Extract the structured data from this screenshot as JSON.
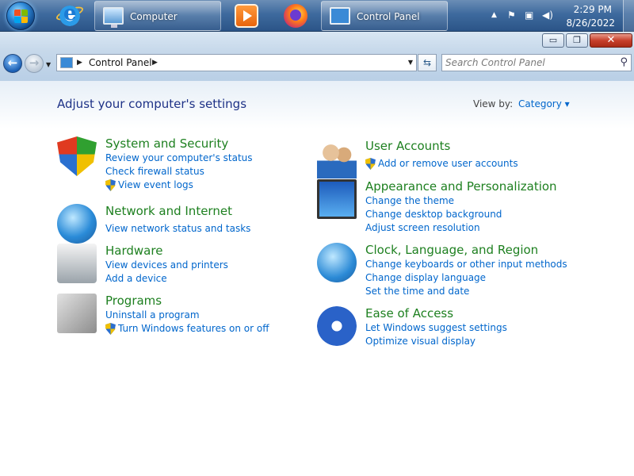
{
  "taskbar": {
    "buttons": [
      {
        "label": "Computer"
      },
      {
        "label": "Control Panel"
      }
    ],
    "clock": {
      "time": "2:29 PM",
      "date": "8/26/2022"
    },
    "tray_icons": [
      "chevron-up-icon",
      "flag-icon",
      "network-icon",
      "speaker-icon"
    ],
    "pinned": [
      "internet-explorer-icon",
      "media-player-icon",
      "firefox-icon"
    ]
  },
  "window": {
    "controls": {
      "minimize": "▭",
      "maximize": "❐",
      "close": "✕"
    }
  },
  "addressbar": {
    "path": "Control Panel",
    "search_placeholder": "Search Control Panel"
  },
  "content": {
    "title": "Adjust your computer's settings",
    "view_by_label": "View by:",
    "view_by_value": "Category ▾",
    "categories_left": [
      {
        "title": "System and Security",
        "icon": "security-shield-icon",
        "links": [
          {
            "text": "Review your computer's status",
            "shield": false
          },
          {
            "text": "Check firewall status",
            "shield": false
          },
          {
            "text": "View event logs",
            "shield": true
          }
        ]
      },
      {
        "title": "Network and Internet",
        "icon": "network-globe-icon",
        "links": [
          {
            "text": "View network status and tasks",
            "shield": false
          }
        ]
      },
      {
        "title": "Hardware",
        "icon": "printer-icon",
        "links": [
          {
            "text": "View devices and printers",
            "shield": false
          },
          {
            "text": "Add a device",
            "shield": false
          }
        ]
      },
      {
        "title": "Programs",
        "icon": "programs-box-icon",
        "links": [
          {
            "text": "Uninstall a program",
            "shield": false
          },
          {
            "text": "Turn Windows features on or off",
            "shield": true
          }
        ]
      }
    ],
    "categories_right": [
      {
        "title": "User Accounts",
        "icon": "users-icon",
        "links": [
          {
            "text": "Add or remove user accounts",
            "shield": true
          }
        ]
      },
      {
        "title": "Appearance and Personalization",
        "icon": "monitor-icon",
        "links": [
          {
            "text": "Change the theme",
            "shield": false
          },
          {
            "text": "Change desktop background",
            "shield": false
          },
          {
            "text": "Adjust screen resolution",
            "shield": false
          }
        ]
      },
      {
        "title": "Clock, Language, and Region",
        "icon": "clock-globe-icon",
        "links": [
          {
            "text": "Change keyboards or other input methods",
            "shield": false
          },
          {
            "text": "Change display language",
            "shield": false
          },
          {
            "text": "Set the time and date",
            "shield": false
          }
        ]
      },
      {
        "title": "Ease of Access",
        "icon": "ease-of-access-icon",
        "links": [
          {
            "text": "Let Windows suggest settings",
            "shield": false
          },
          {
            "text": "Optimize visual display",
            "shield": false
          }
        ]
      }
    ]
  }
}
